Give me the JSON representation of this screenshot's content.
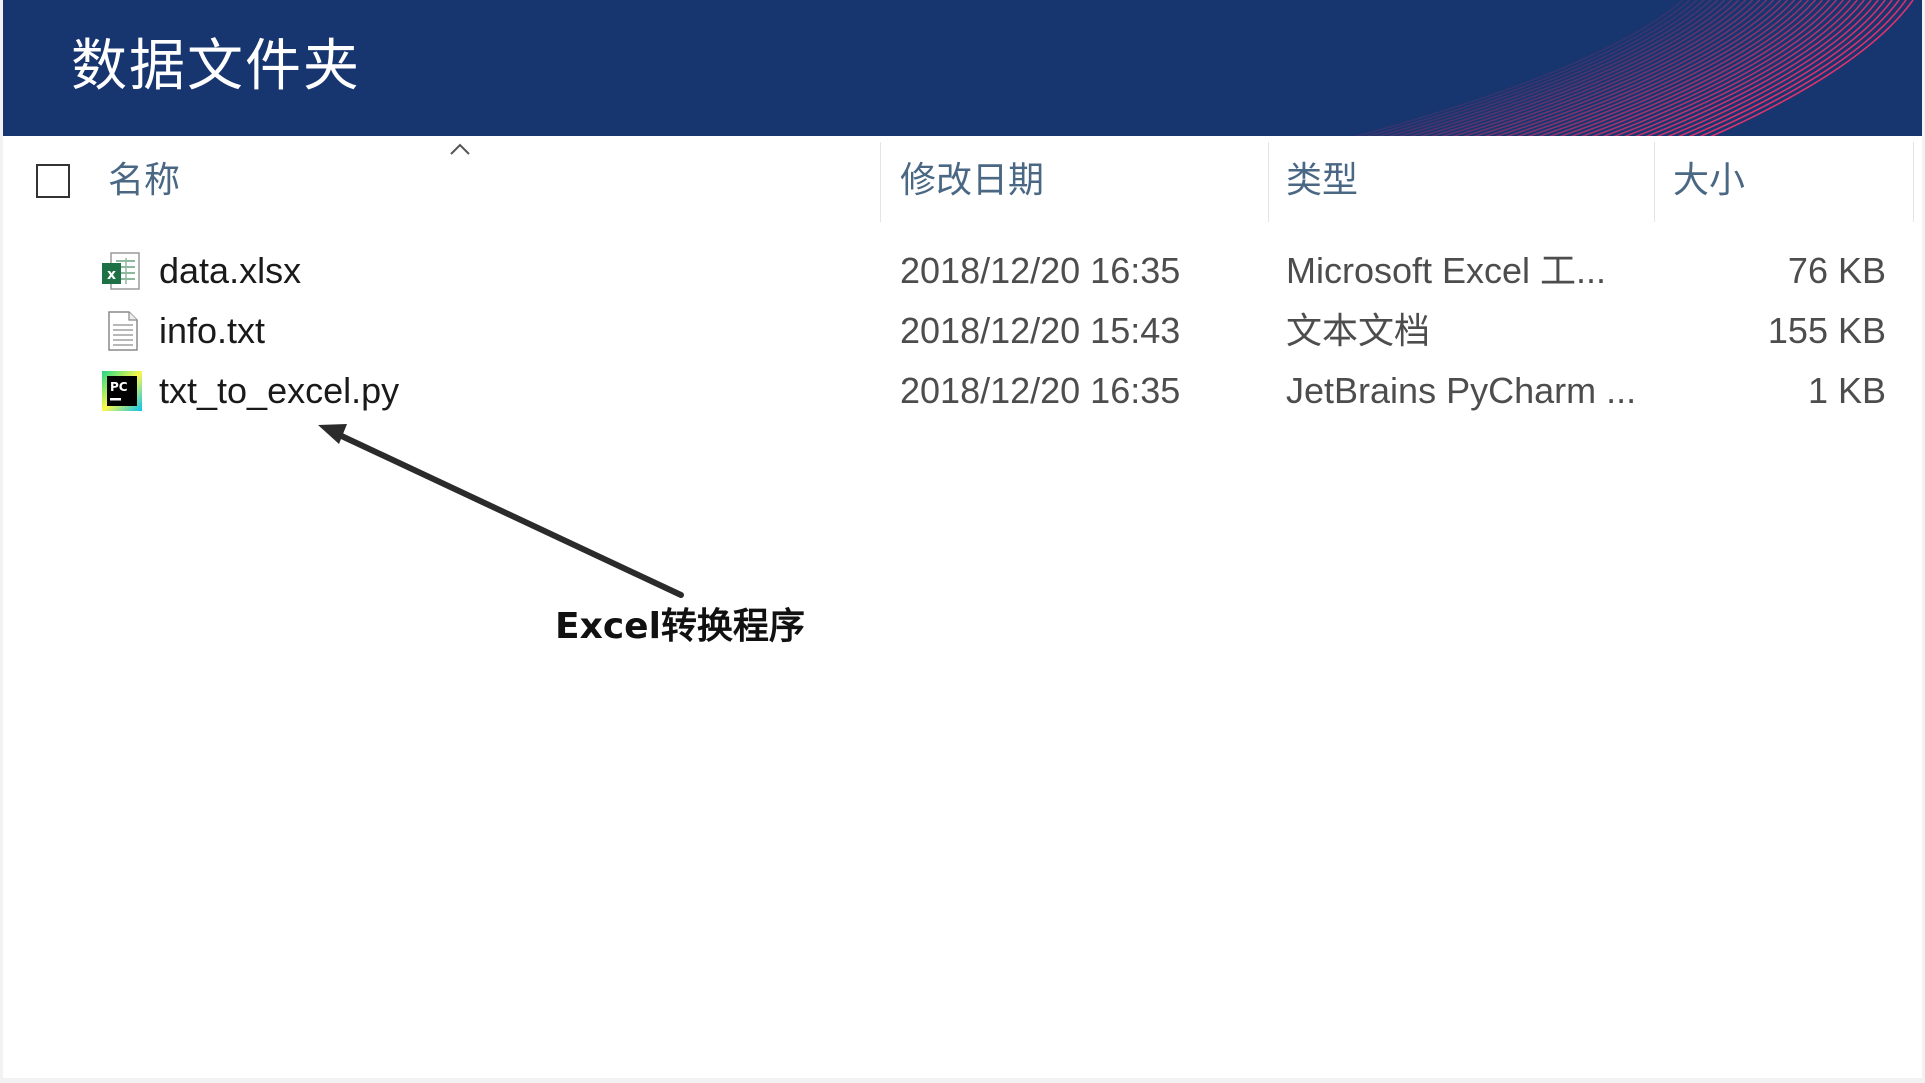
{
  "banner": {
    "title": "数据文件夹"
  },
  "table": {
    "columns": {
      "name": "名称",
      "modified": "修改日期",
      "type": "类型",
      "size": "大小"
    },
    "rows": [
      {
        "name": "data.xlsx",
        "modified": "2018/12/20 16:35",
        "type": "Microsoft Excel 工...",
        "size": "76 KB",
        "icon": "excel-file-icon"
      },
      {
        "name": "info.txt",
        "modified": "2018/12/20 15:43",
        "type": "文本文档",
        "size": "155 KB",
        "icon": "text-file-icon"
      },
      {
        "name": "txt_to_excel.py",
        "modified": "2018/12/20 16:35",
        "type": "JetBrains PyCharm ...",
        "size": "1 KB",
        "icon": "pycharm-file-icon"
      }
    ]
  },
  "annotation": {
    "label": "Excel转换程序"
  },
  "colors": {
    "banner": "#17356f",
    "accent_lines": "#e0336e",
    "header_text": "#4a6784"
  }
}
